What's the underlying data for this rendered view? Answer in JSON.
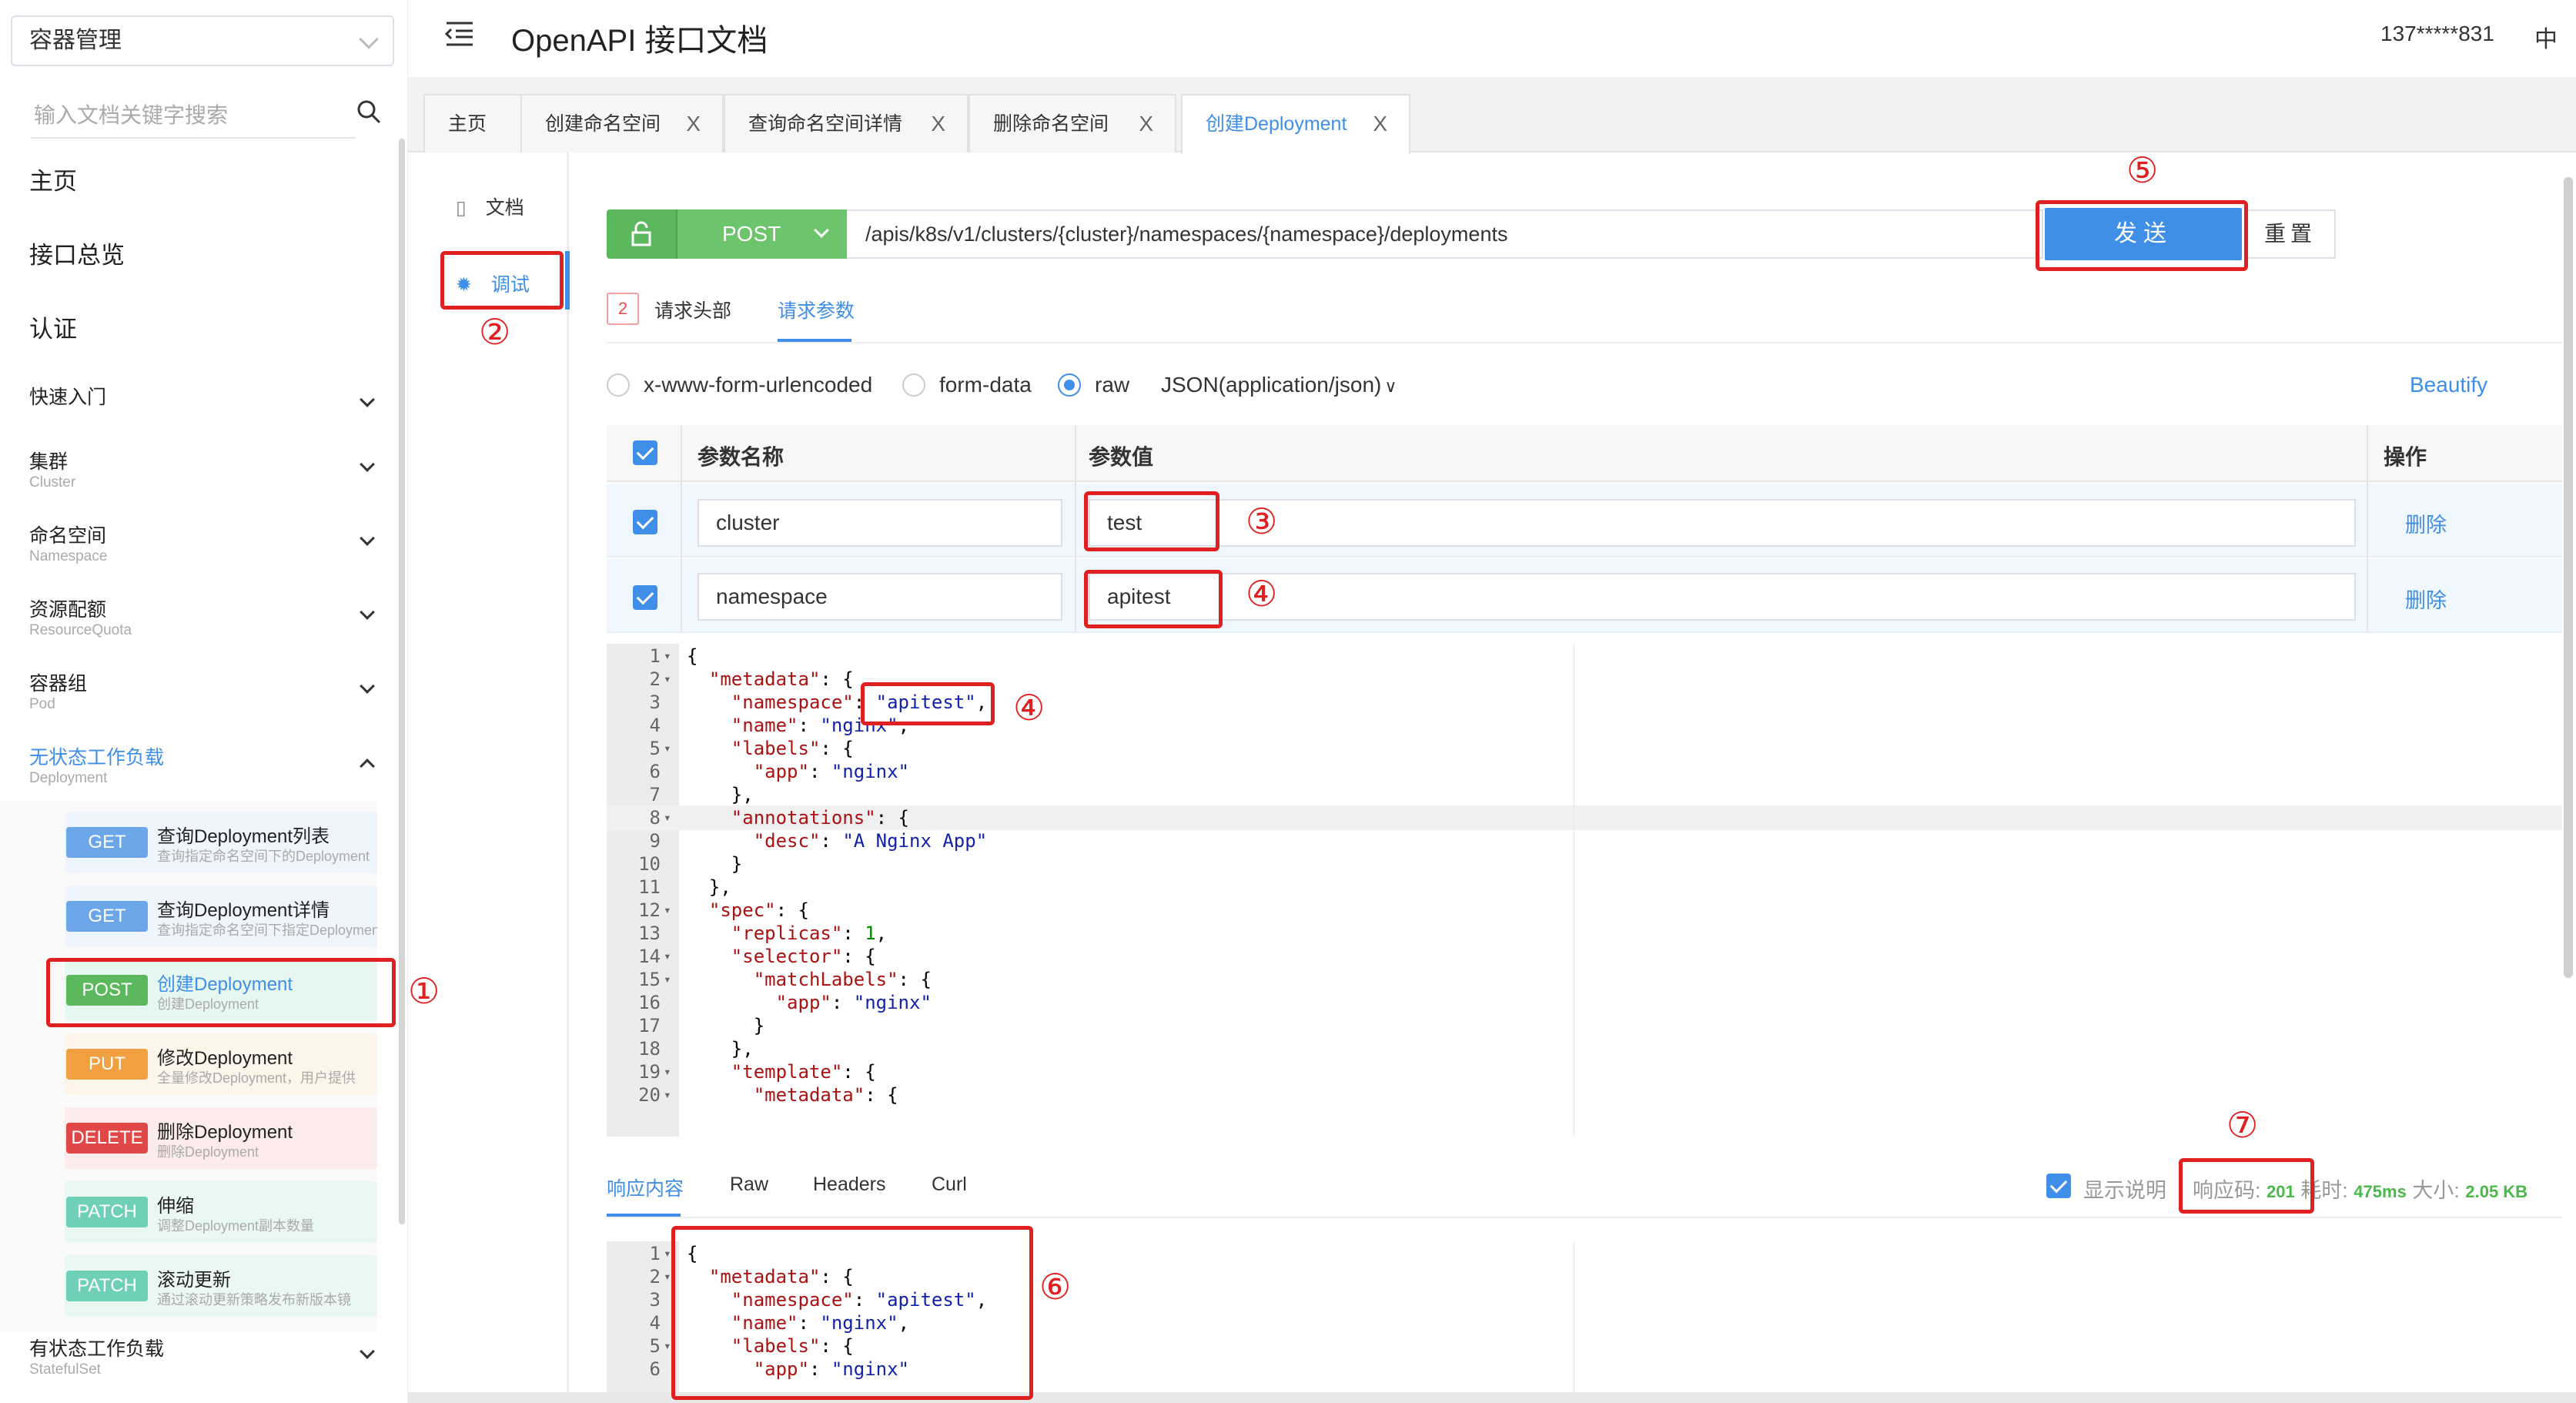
{
  "sidebar": {
    "select_value": "容器管理",
    "search_placeholder": "输入文档关键字搜索",
    "top_items": [
      "主页",
      "接口总览",
      "认证"
    ],
    "groups": [
      {
        "title": "快速入门",
        "sub": ""
      },
      {
        "title": "集群",
        "sub": "Cluster"
      },
      {
        "title": "命名空间",
        "sub": "Namespace"
      },
      {
        "title": "资源配额",
        "sub": "ResourceQuota"
      },
      {
        "title": "容器组",
        "sub": "Pod"
      },
      {
        "title": "无状态工作负载",
        "sub": "Deployment"
      },
      {
        "title": "有状态工作负载",
        "sub": "StatefulSet"
      }
    ],
    "api_items": [
      {
        "method": "GET",
        "name": "查询Deployment列表",
        "desc": "查询指定命名空间下的Deployment",
        "color": "#6aa6e8"
      },
      {
        "method": "GET",
        "name": "查询Deployment详情",
        "desc": "查询指定命名空间下指定Deployment",
        "color": "#6aa6e8"
      },
      {
        "method": "POST",
        "name": "创建Deployment",
        "desc": "创建Deployment",
        "color": "#5cb85c"
      },
      {
        "method": "PUT",
        "name": "修改Deployment",
        "desc": "全量修改Deployment，用户提供",
        "color": "#f0a040"
      },
      {
        "method": "DELETE",
        "name": "删除Deployment",
        "desc": "删除Deployment",
        "color": "#e04848"
      },
      {
        "method": "PATCH",
        "name": "伸缩",
        "desc": "调整Deployment副本数量",
        "color": "#6fd0b8"
      },
      {
        "method": "PATCH",
        "name": "滚动更新",
        "desc": "通过滚动更新策略发布新版本镜",
        "color": "#6fd0b8"
      }
    ]
  },
  "header": {
    "title": "OpenAPI 接口文档",
    "user": "137*****831",
    "lang": "中"
  },
  "tabs": [
    "主页",
    "创建命名空间",
    "查询命名空间详情",
    "删除命名空间",
    "创建Deployment"
  ],
  "tab_close": "X",
  "side_options": {
    "doc": "文档",
    "debug": "调试"
  },
  "request": {
    "method": "POST",
    "url": "/apis/k8s/v1/clusters/{cluster}/namespaces/{namespace}/deployments",
    "send": "发送",
    "reset": "重置"
  },
  "subtabs": {
    "badge": "2",
    "headers": "请求头部",
    "params": "请求参数"
  },
  "body_types": [
    "x-www-form-urlencoded",
    "form-data",
    "raw"
  ],
  "content_type": "JSON(application/json)",
  "beautify": "Beautify",
  "params_table": {
    "headers": [
      "参数名称",
      "参数值",
      "操作"
    ],
    "rows": [
      {
        "name": "cluster",
        "value": "test",
        "action": "删除"
      },
      {
        "name": "namespace",
        "value": "apitest",
        "action": "删除"
      }
    ]
  },
  "request_body_lines": [
    {
      "n": "1",
      "f": "▾",
      "t": "{"
    },
    {
      "n": "2",
      "f": "▾",
      "t": "  \"metadata\": {"
    },
    {
      "n": "3",
      "f": "",
      "t": "    \"namespace\": \"apitest\","
    },
    {
      "n": "4",
      "f": "",
      "t": "    \"name\": \"nginx\","
    },
    {
      "n": "5",
      "f": "▾",
      "t": "    \"labels\": {"
    },
    {
      "n": "6",
      "f": "",
      "t": "      \"app\": \"nginx\""
    },
    {
      "n": "7",
      "f": "",
      "t": "    },"
    },
    {
      "n": "8",
      "f": "▾",
      "t": "    \"annotations\": {"
    },
    {
      "n": "9",
      "f": "",
      "t": "      \"desc\": \"A Nginx App\""
    },
    {
      "n": "10",
      "f": "",
      "t": "    }"
    },
    {
      "n": "11",
      "f": "",
      "t": "  },"
    },
    {
      "n": "12",
      "f": "▾",
      "t": "  \"spec\": {"
    },
    {
      "n": "13",
      "f": "",
      "t": "    \"replicas\": 1,"
    },
    {
      "n": "14",
      "f": "▾",
      "t": "    \"selector\": {"
    },
    {
      "n": "15",
      "f": "▾",
      "t": "      \"matchLabels\": {"
    },
    {
      "n": "16",
      "f": "",
      "t": "        \"app\": \"nginx\""
    },
    {
      "n": "17",
      "f": "",
      "t": "      }"
    },
    {
      "n": "18",
      "f": "",
      "t": "    },"
    },
    {
      "n": "19",
      "f": "▾",
      "t": "    \"template\": {"
    },
    {
      "n": "20",
      "f": "▾",
      "t": "      \"metadata\": {"
    }
  ],
  "response": {
    "tabs": [
      "响应内容",
      "Raw",
      "Headers",
      "Curl"
    ],
    "show_desc": "显示说明",
    "code_label": "响应码:",
    "code": "201",
    "time_label": "耗时:",
    "time": "475ms",
    "size_label": "大小:",
    "size": "2.05 KB",
    "lines": [
      {
        "n": "1",
        "f": "▾",
        "t": "{"
      },
      {
        "n": "2",
        "f": "▾",
        "t": "  \"metadata\": {"
      },
      {
        "n": "3",
        "f": "",
        "t": "    \"namespace\": \"apitest\","
      },
      {
        "n": "4",
        "f": "",
        "t": "    \"name\": \"nginx\","
      },
      {
        "n": "5",
        "f": "▾",
        "t": "    \"labels\": {"
      },
      {
        "n": "6",
        "f": "",
        "t": "      \"app\": \"nginx\""
      }
    ]
  },
  "annotations": [
    "①",
    "②",
    "③",
    "④",
    "④",
    "⑤",
    "⑥",
    "⑦"
  ]
}
